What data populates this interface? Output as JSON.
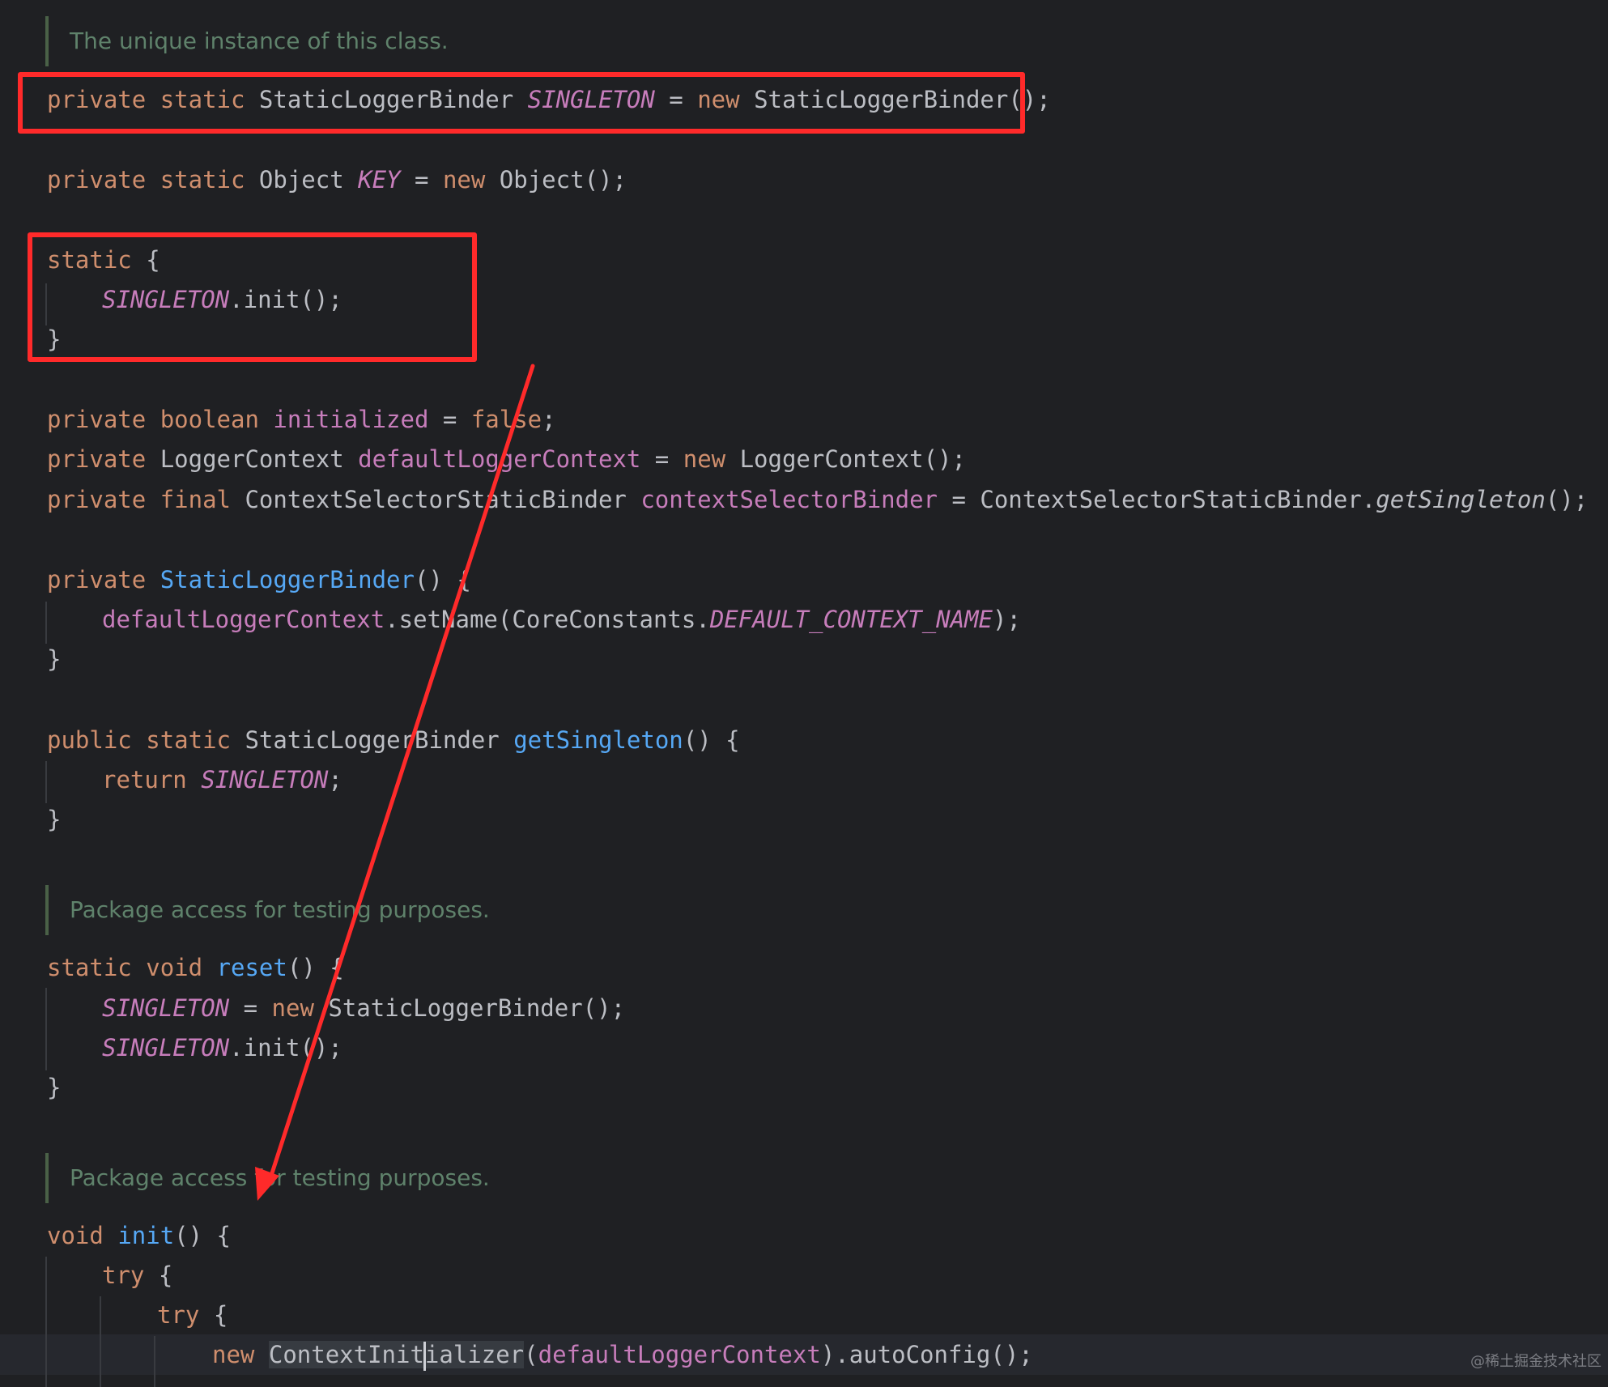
{
  "comments": {
    "c1": "The unique instance of this class.",
    "c2": "Package access for testing purposes.",
    "c3": "Package access for testing purposes."
  },
  "tokens": {
    "private": "private",
    "public": "public",
    "static": "static",
    "final": "final",
    "new": "new",
    "boolean": "boolean",
    "false": "false",
    "return": "return",
    "void": "void",
    "try": "try",
    "StaticLoggerBinder": "StaticLoggerBinder",
    "Object": "Object",
    "LoggerContext": "LoggerContext",
    "ContextSelectorStaticBinder": "ContextSelectorStaticBinder",
    "CoreConstants": "CoreConstants",
    "ContextInit": "ContextInit",
    "ializer": "ializer",
    "SINGLETON": "SINGLETON",
    "KEY": "KEY",
    "DEFAULT_CONTEXT_NAME": "DEFAULT_CONTEXT_NAME",
    "initialized": "initialized",
    "defaultLoggerContext": "defaultLoggerContext",
    "contextSelectorBinder": "contextSelectorBinder",
    "getSingleton": "getSingleton",
    "reset": "reset",
    "init": "init",
    "setName": "setName",
    "autoConfig": "autoConfig",
    "ctor_end": "();",
    "open_brace": "{",
    "close_brace": "}",
    "empty_parens": "()",
    "semicolon": ";",
    "eq": " = ",
    "dot": ".",
    "lparen": "(",
    "rparen": ")",
    "call_end": "();"
  },
  "annotations": {
    "box_color": "#ff2a2a",
    "arrow_color": "#ff2a2a"
  },
  "watermark": "@稀土掘金技术社区"
}
